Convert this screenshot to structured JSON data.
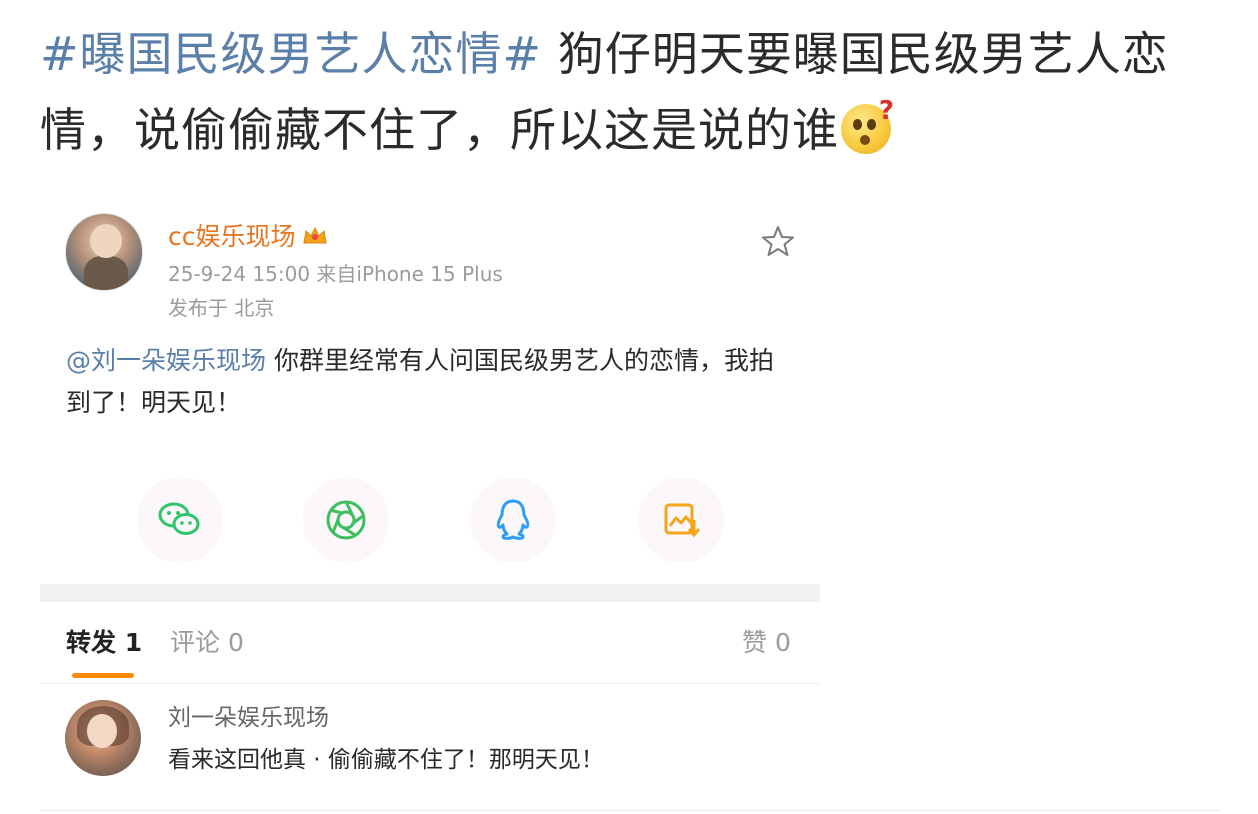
{
  "headline": {
    "hashtag": "#曝国民级男艺人恋情#",
    "text": " 狗仔明天要曝国民级男艺人恋情，说偷偷藏不住了，所以这是说的谁",
    "emoji": "surprised-question-emoji"
  },
  "post": {
    "author": "cc娱乐现场",
    "author_badge": "crown-icon",
    "datetime_source": "25-9-24 15:00  来自iPhone 15 Plus",
    "location": "发布于 北京",
    "mention": "@刘一朵娱乐现场",
    "body": " 你群里经常有人问国民级男艺人的恋情，我拍到了！明天见！"
  },
  "share": [
    {
      "name": "wechat-icon",
      "color": "#2fc66b"
    },
    {
      "name": "moments-icon",
      "color": "#3cbf5c"
    },
    {
      "name": "qq-icon",
      "color": "#2e9ef5"
    },
    {
      "name": "save-image-icon",
      "color": "#f5a51c"
    }
  ],
  "tabs": {
    "repost": "转发 1",
    "comment": "评论 0",
    "like": "赞 0"
  },
  "reposts": [
    {
      "name": "刘一朵娱乐现场",
      "text": "看来这回他真 · 偷偷藏不住了！那明天见！"
    }
  ]
}
